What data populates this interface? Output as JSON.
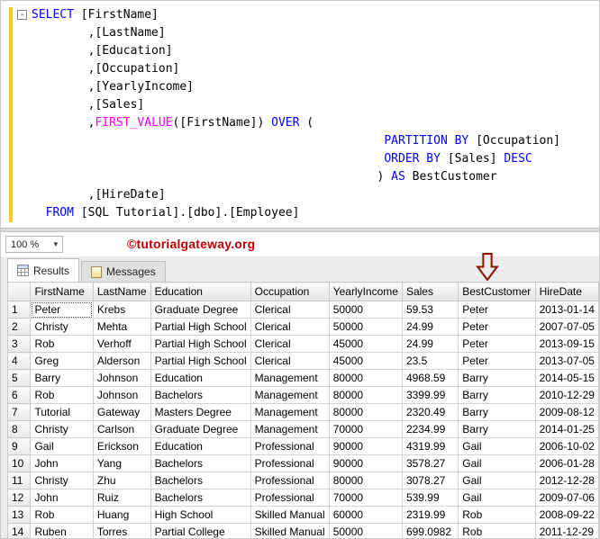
{
  "colors": {
    "keyword": "#0000ff",
    "function": "#ff00ff",
    "watermark": "#c00000",
    "arrow": "#8b1500",
    "trackbar": "#f2cb1d"
  },
  "editor": {
    "lines": [
      {
        "collapse": "-",
        "segs": [
          [
            "k",
            "SELECT"
          ],
          [
            "n",
            " [FirstName]"
          ]
        ]
      },
      {
        "segs": [
          [
            "n",
            "        ,[LastName]"
          ]
        ]
      },
      {
        "segs": [
          [
            "n",
            "        ,[Education]"
          ]
        ]
      },
      {
        "segs": [
          [
            "n",
            "        ,[Occupation]"
          ]
        ]
      },
      {
        "segs": [
          [
            "n",
            "        ,[YearlyIncome]"
          ]
        ]
      },
      {
        "segs": [
          [
            "n",
            "        ,[Sales]"
          ]
        ]
      },
      {
        "segs": [
          [
            "n",
            "        ,"
          ],
          [
            "f",
            "FIRST_VALUE"
          ],
          [
            "n",
            "([FirstName]) "
          ],
          [
            "k",
            "OVER"
          ],
          [
            "n",
            " ("
          ]
        ]
      },
      {
        "segs": [
          [
            "n",
            "                                                  "
          ],
          [
            "k",
            "PARTITION BY"
          ],
          [
            "n",
            " [Occupation]"
          ]
        ]
      },
      {
        "segs": [
          [
            "n",
            "                                                  "
          ],
          [
            "k",
            "ORDER BY"
          ],
          [
            "n",
            " [Sales] "
          ],
          [
            "k",
            "DESC"
          ]
        ]
      },
      {
        "segs": [
          [
            "n",
            "                                                 "
          ],
          [
            "n",
            ") "
          ],
          [
            "k",
            "AS"
          ],
          [
            "n",
            " BestCustomer"
          ]
        ]
      },
      {
        "segs": [
          [
            "n",
            "        ,[HireDate]"
          ]
        ]
      },
      {
        "segs": [
          [
            "n",
            "  "
          ],
          [
            "k",
            "FROM"
          ],
          [
            "n",
            " [SQL Tutorial].[dbo].[Employee]"
          ]
        ]
      }
    ]
  },
  "statusbar": {
    "zoom": "100 %",
    "watermark": "©tutorialgateway.org"
  },
  "tabs": [
    {
      "label": "Results",
      "icon": "icon-results",
      "active": true
    },
    {
      "label": "Messages",
      "icon": "icon-messages",
      "active": false
    }
  ],
  "grid": {
    "columns": [
      "FirstName",
      "LastName",
      "Education",
      "Occupation",
      "YearlyIncome",
      "Sales",
      "BestCustomer",
      "HireDate"
    ],
    "rows": [
      [
        "Peter",
        "Krebs",
        "Graduate Degree",
        "Clerical",
        "50000",
        "59.53",
        "Peter",
        "2013-01-14"
      ],
      [
        "Christy",
        "Mehta",
        "Partial High School",
        "Clerical",
        "50000",
        "24.99",
        "Peter",
        "2007-07-05"
      ],
      [
        "Rob",
        "Verhoff",
        "Partial High School",
        "Clerical",
        "45000",
        "24.99",
        "Peter",
        "2013-09-15"
      ],
      [
        "Greg",
        "Alderson",
        "Partial High School",
        "Clerical",
        "45000",
        "23.5",
        "Peter",
        "2013-07-05"
      ],
      [
        "Barry",
        "Johnson",
        "Education",
        "Management",
        "80000",
        "4968.59",
        "Barry",
        "2014-05-15"
      ],
      [
        "Rob",
        "Johnson",
        "Bachelors",
        "Management",
        "80000",
        "3399.99",
        "Barry",
        "2010-12-29"
      ],
      [
        "Tutorial",
        "Gateway",
        "Masters Degree",
        "Management",
        "80000",
        "2320.49",
        "Barry",
        "2009-08-12"
      ],
      [
        "Christy",
        "Carlson",
        "Graduate Degree",
        "Management",
        "70000",
        "2234.99",
        "Barry",
        "2014-01-25"
      ],
      [
        "Gail",
        "Erickson",
        "Education",
        "Professional",
        "90000",
        "4319.99",
        "Gail",
        "2006-10-02"
      ],
      [
        "John",
        "Yang",
        "Bachelors",
        "Professional",
        "90000",
        "3578.27",
        "Gail",
        "2006-01-28"
      ],
      [
        "Christy",
        "Zhu",
        "Bachelors",
        "Professional",
        "80000",
        "3078.27",
        "Gail",
        "2012-12-28"
      ],
      [
        "John",
        "Ruiz",
        "Bachelors",
        "Professional",
        "70000",
        "539.99",
        "Gail",
        "2009-07-06"
      ],
      [
        "Rob",
        "Huang",
        "High School",
        "Skilled Manual",
        "60000",
        "2319.99",
        "Rob",
        "2008-09-22"
      ],
      [
        "Ruben",
        "Torres",
        "Partial College",
        "Skilled Manual",
        "50000",
        "699.0982",
        "Rob",
        "2011-12-29"
      ]
    ]
  },
  "annotation": {
    "type": "down-arrow",
    "points_to_column": "BestCustomer"
  }
}
